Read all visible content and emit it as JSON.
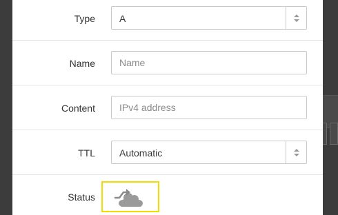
{
  "form": {
    "type": {
      "label": "Type",
      "value": "A"
    },
    "name": {
      "label": "Name",
      "placeholder": "Name",
      "value": ""
    },
    "content": {
      "label": "Content",
      "placeholder": "IPv4 address",
      "value": ""
    },
    "ttl": {
      "label": "TTL",
      "value": "Automatic"
    },
    "status": {
      "label": "Status",
      "icon": "cloud-dns-only-icon",
      "highlight_color": "#f2dd00"
    }
  }
}
